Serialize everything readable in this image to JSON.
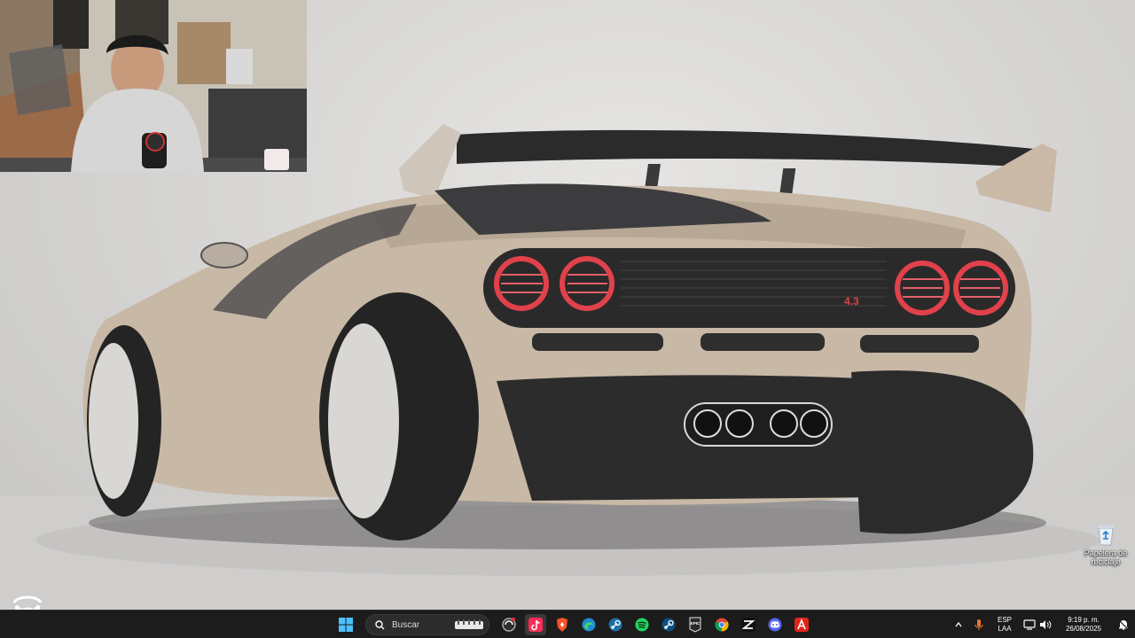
{
  "desktop": {
    "recycle_bin": {
      "label": "Papelera de reciclaje",
      "icon": "recycle-bin-icon"
    }
  },
  "taskbar": {
    "search_placeholder": "Buscar",
    "apps": [
      {
        "name": "copilot",
        "icon": "copilot-icon"
      },
      {
        "name": "tiktok",
        "icon": "tiktok-icon"
      },
      {
        "name": "brave",
        "icon": "brave-icon"
      },
      {
        "name": "edge",
        "icon": "edge-icon"
      },
      {
        "name": "steam",
        "icon": "steam-icon"
      },
      {
        "name": "spotify",
        "icon": "spotify-icon"
      },
      {
        "name": "steam-2",
        "icon": "steam-icon"
      },
      {
        "name": "epic-games",
        "icon": "epic-games-icon",
        "text": "EPIC"
      },
      {
        "name": "chrome",
        "icon": "chrome-icon"
      },
      {
        "name": "capcut",
        "icon": "capcut-icon"
      },
      {
        "name": "discord",
        "icon": "discord-icon"
      },
      {
        "name": "adobe",
        "icon": "adobe-icon"
      }
    ],
    "tray": {
      "lang_line1": "ESP",
      "lang_line2": "LAA",
      "time": "9:19 p. m.",
      "date": "26/08/2025"
    }
  },
  "wallpaper": {
    "plate_badge": "4.3"
  }
}
